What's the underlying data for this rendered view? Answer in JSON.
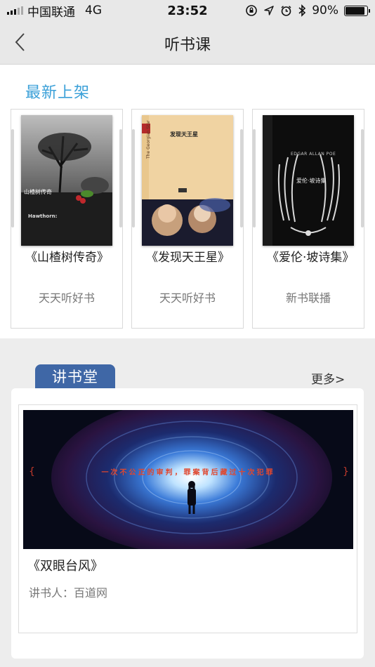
{
  "status_bar": {
    "carrier": "中国联通",
    "network": "4G",
    "time": "23:52",
    "battery": "90%",
    "battery_level": 0.9
  },
  "nav": {
    "title": "听书课",
    "back_icon": "chevron-left-icon"
  },
  "new_arrivals": {
    "title": "最新上架",
    "books": [
      {
        "title": "《山楂树传奇》",
        "source": "天天听好书",
        "cover_text": {
          "main": "山楂树传奇",
          "sub": "Hawthorn:"
        }
      },
      {
        "title": "《发现天王星》",
        "source": "天天听好书",
        "cover_text": {
          "main": "发现天王星",
          "sub": "The Georgian Star"
        }
      },
      {
        "title": "《爱伦·坡诗集》",
        "source": "新书联播",
        "cover_text": {
          "main": "爱伦·坡诗集",
          "sub": "EDGAR ALLAN POE"
        }
      }
    ]
  },
  "lecture_hall": {
    "tab_label": "讲书堂",
    "more_label": "更多>",
    "item": {
      "title": "《双眼台风》",
      "speaker": "讲书人：百道网",
      "banner_text": "一次不公正的审判，罪案背后藏过十次犯罪"
    }
  },
  "colors": {
    "accent_blue": "#3ba0d8",
    "tab_blue": "#3f67a6",
    "background": "#ededed"
  }
}
